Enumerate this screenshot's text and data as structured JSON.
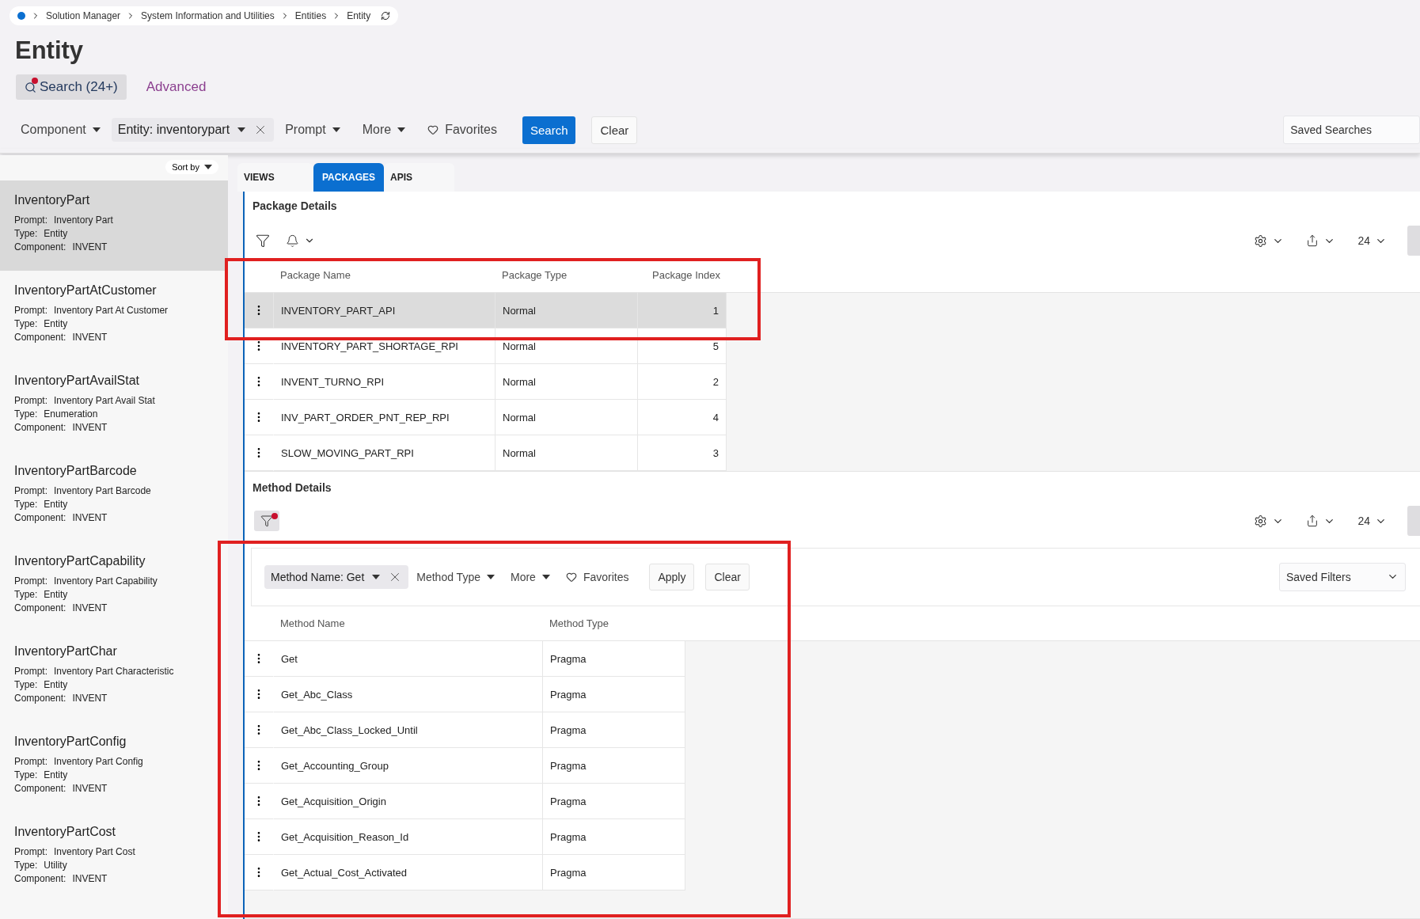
{
  "breadcrumb": [
    "Solution Manager",
    "System Information and Utilities",
    "Entities",
    "Entity"
  ],
  "page_title": "Entity",
  "search_modes": [
    {
      "label": "Search (24+)",
      "selected": true
    },
    {
      "label": "Advanced",
      "selected": false
    }
  ],
  "search_filters": [
    {
      "kind": "dropdown",
      "label": "Component"
    },
    {
      "kind": "chip",
      "label": "Entity: inventorypart"
    },
    {
      "kind": "dropdown",
      "label": "Prompt"
    },
    {
      "kind": "dropdown",
      "label": "More"
    },
    {
      "kind": "favorites",
      "label": "Favorites"
    }
  ],
  "search_button": "Search",
  "clear_button": "Clear",
  "saved_searches": "Saved Searches",
  "sidebar": {
    "sort_label": "Sort by",
    "items": [
      {
        "name": "InventoryPart",
        "selected": true,
        "fields": [
          {
            "label": "Prompt:",
            "value": "Inventory Part"
          },
          {
            "label": "Type:",
            "value": "Entity"
          },
          {
            "label": "Component:",
            "value": "INVENT"
          }
        ]
      },
      {
        "name": "InventoryPartAtCustomer",
        "selected": false,
        "fields": [
          {
            "label": "Prompt:",
            "value": "Inventory Part At Customer"
          },
          {
            "label": "Type:",
            "value": "Entity"
          },
          {
            "label": "Component:",
            "value": "INVENT"
          }
        ]
      },
      {
        "name": "InventoryPartAvailStat",
        "selected": false,
        "fields": [
          {
            "label": "Prompt:",
            "value": "Inventory Part Avail Stat"
          },
          {
            "label": "Type:",
            "value": "Enumeration"
          },
          {
            "label": "Component:",
            "value": "INVENT"
          }
        ]
      },
      {
        "name": "InventoryPartBarcode",
        "selected": false,
        "fields": [
          {
            "label": "Prompt:",
            "value": "Inventory Part Barcode"
          },
          {
            "label": "Type:",
            "value": "Entity"
          },
          {
            "label": "Component:",
            "value": "INVENT"
          }
        ]
      },
      {
        "name": "InventoryPartCapability",
        "selected": false,
        "fields": [
          {
            "label": "Prompt:",
            "value": "Inventory Part Capability"
          },
          {
            "label": "Type:",
            "value": "Entity"
          },
          {
            "label": "Component:",
            "value": "INVENT"
          }
        ]
      },
      {
        "name": "InventoryPartChar",
        "selected": false,
        "fields": [
          {
            "label": "Prompt:",
            "value": "Inventory Part Characteristic"
          },
          {
            "label": "Type:",
            "value": "Entity"
          },
          {
            "label": "Component:",
            "value": "INVENT"
          }
        ]
      },
      {
        "name": "InventoryPartConfig",
        "selected": false,
        "fields": [
          {
            "label": "Prompt:",
            "value": "Inventory Part Config"
          },
          {
            "label": "Type:",
            "value": "Entity"
          },
          {
            "label": "Component:",
            "value": "INVENT"
          }
        ]
      },
      {
        "name": "InventoryPartCost",
        "selected": false,
        "fields": [
          {
            "label": "Prompt:",
            "value": "Inventory Part Cost"
          },
          {
            "label": "Type:",
            "value": "Utility"
          },
          {
            "label": "Component:",
            "value": "INVENT"
          }
        ]
      }
    ]
  },
  "tabs": [
    {
      "label": "VIEWS",
      "selected": false
    },
    {
      "label": "PACKAGES",
      "selected": true
    },
    {
      "label": "APIS",
      "selected": false
    }
  ],
  "package_details": {
    "title": "Package Details",
    "page_size": "24",
    "columns": [
      "Package Name",
      "Package Type",
      "Package Index"
    ],
    "rows": [
      {
        "name": "INVENTORY_PART_API",
        "type": "Normal",
        "index": "1",
        "selected": true
      },
      {
        "name": "INVENTORY_PART_SHORTAGE_RPI",
        "type": "Normal",
        "index": "5",
        "selected": false
      },
      {
        "name": "INVENT_TURNO_RPI",
        "type": "Normal",
        "index": "2",
        "selected": false
      },
      {
        "name": "INV_PART_ORDER_PNT_REP_RPI",
        "type": "Normal",
        "index": "4",
        "selected": false
      },
      {
        "name": "SLOW_MOVING_PART_RPI",
        "type": "Normal",
        "index": "3",
        "selected": false
      }
    ]
  },
  "method_details": {
    "title": "Method Details",
    "filter_active": true,
    "page_size": "24",
    "filters": [
      {
        "kind": "chip",
        "label": "Method Name: Get"
      },
      {
        "kind": "dropdown",
        "label": "Method Type"
      },
      {
        "kind": "dropdown",
        "label": "More"
      },
      {
        "kind": "favorites",
        "label": "Favorites"
      }
    ],
    "apply_button": "Apply",
    "clear_button": "Clear",
    "saved_filters": "Saved Filters",
    "columns": [
      "Method Name",
      "Method Type"
    ],
    "rows": [
      {
        "name": "Get",
        "type": "Pragma"
      },
      {
        "name": "Get_Abc_Class",
        "type": "Pragma"
      },
      {
        "name": "Get_Abc_Class_Locked_Until",
        "type": "Pragma"
      },
      {
        "name": "Get_Accounting_Group",
        "type": "Pragma"
      },
      {
        "name": "Get_Acquisition_Origin",
        "type": "Pragma"
      },
      {
        "name": "Get_Acquisition_Reason_Id",
        "type": "Pragma"
      },
      {
        "name": "Get_Actual_Cost_Activated",
        "type": "Pragma"
      }
    ]
  }
}
